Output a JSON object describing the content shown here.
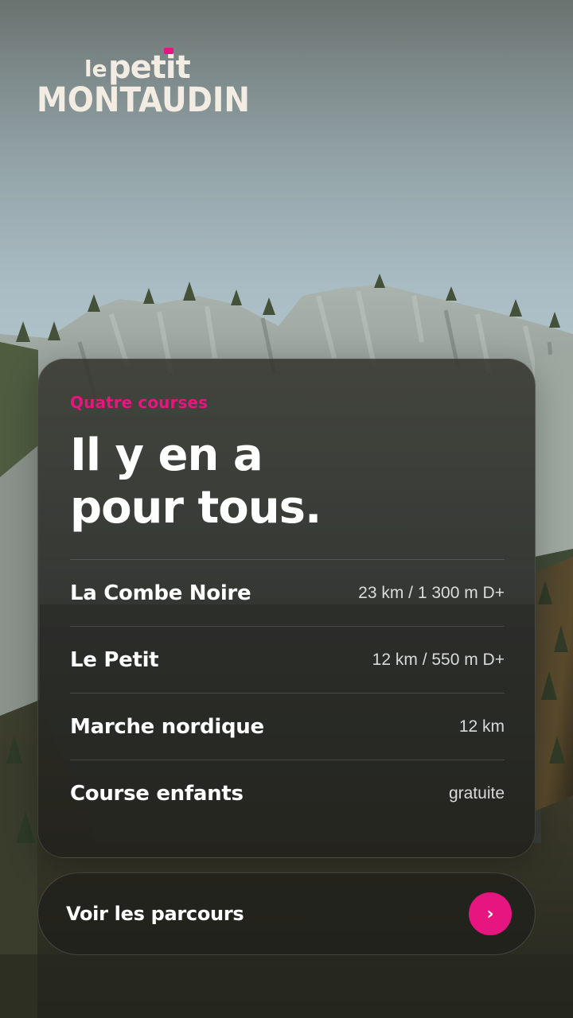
{
  "brand": {
    "logo_line1_small": "le",
    "logo_line1_large": "petit",
    "logo_line2": "MONTAUDIN",
    "accent_color": "#e6157f"
  },
  "card": {
    "eyebrow": "Quatre courses",
    "headline_line1": "Il y en a",
    "headline_line2": "pour tous.",
    "courses": [
      {
        "name": "La Combe Noire",
        "meta": "23 km / 1 300 m D+"
      },
      {
        "name": "Le Petit",
        "meta": "12 km / 550 m D+"
      },
      {
        "name": "Marche nordique",
        "meta": "12 km"
      },
      {
        "name": "Course enfants",
        "meta": "gratuite"
      }
    ]
  },
  "cta": {
    "label": "Voir les parcours",
    "icon": "chevron-right-icon",
    "glyph": "›"
  }
}
